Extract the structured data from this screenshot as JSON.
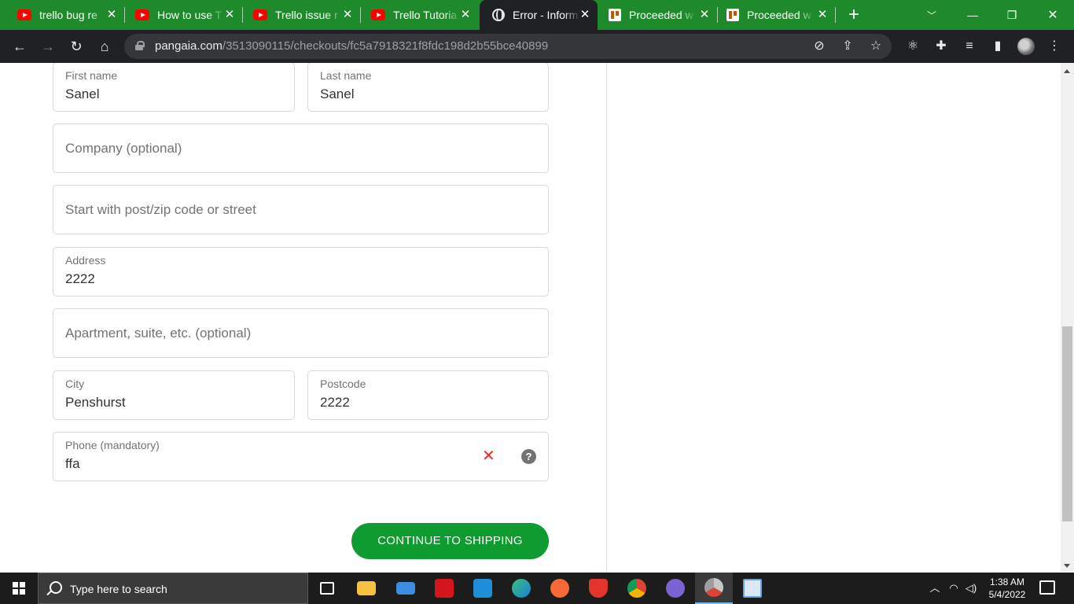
{
  "browser": {
    "tabs": [
      {
        "title": "trello bug re",
        "icon": "youtube-icon",
        "active": false
      },
      {
        "title": "How to use T",
        "icon": "youtube-icon",
        "active": false
      },
      {
        "title": "Trello issue r",
        "icon": "youtube-icon",
        "active": false
      },
      {
        "title": "Trello Tutoria",
        "icon": "youtube-icon",
        "active": false
      },
      {
        "title": "Error - Inform",
        "icon": "globe-icon",
        "active": true
      },
      {
        "title": "Proceeded w",
        "icon": "trello-icon",
        "active": false
      },
      {
        "title": "Proceeded w",
        "icon": "trello-icon",
        "active": false
      }
    ],
    "url_host": "pangaia.com",
    "url_path": "/3513090115/checkouts/fc5a7918321f8fdc198d2b55bce40899"
  },
  "form": {
    "first_name": {
      "label": "First name",
      "value": "Sanel"
    },
    "last_name": {
      "label": "Last name",
      "value": "Sanel"
    },
    "company": {
      "placeholder": "Company (optional)"
    },
    "lookup": {
      "placeholder": "Start with post/zip code or street"
    },
    "address": {
      "label": "Address",
      "value": "2222"
    },
    "apartment": {
      "placeholder": "Apartment, suite, etc. (optional)"
    },
    "city": {
      "label": "City",
      "value": "Penshurst"
    },
    "postcode": {
      "label": "Postcode",
      "value": "2222"
    },
    "phone": {
      "label": "Phone (mandatory)",
      "value": "ffa",
      "error_color": "#e32c2b"
    },
    "continue_label": "CONTINUE TO SHIPPING",
    "accent_color": "#0e9b2f"
  },
  "taskbar": {
    "search_placeholder": "Type here to search",
    "time": "1:38 AM",
    "date": "5/4/2022"
  }
}
